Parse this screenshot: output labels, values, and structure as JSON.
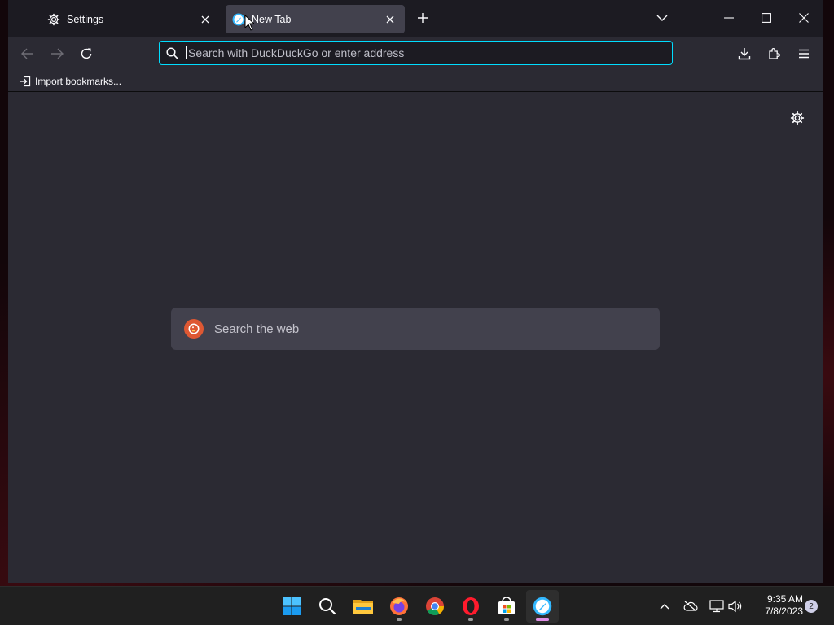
{
  "tabs": [
    {
      "title": "Settings",
      "icon": "gear-icon",
      "active": false
    },
    {
      "title": "New Tab",
      "icon": "browser-logo-icon",
      "active": true
    }
  ],
  "navbar": {
    "url_placeholder": "Search with DuckDuckGo or enter address",
    "url_value": ""
  },
  "bookmarks": {
    "import_label": "Import bookmarks..."
  },
  "newtab": {
    "search_placeholder": "Search the web",
    "search_engine_icon": "duckduckgo-icon"
  },
  "taskbar": {
    "apps": [
      "start-icon",
      "search-icon",
      "file-explorer-icon",
      "firefox-icon",
      "chrome-icon",
      "opera-icon",
      "microsoft-store-icon",
      "browser-logo-icon"
    ],
    "time": "9:35 AM",
    "date": "7/8/2023",
    "notifications": "2"
  },
  "colors": {
    "accent_focus": "#00ddff",
    "toolbar_bg": "#2b2a33",
    "tabstrip_bg": "#1c1b22",
    "ddg_orange": "#de5833"
  }
}
